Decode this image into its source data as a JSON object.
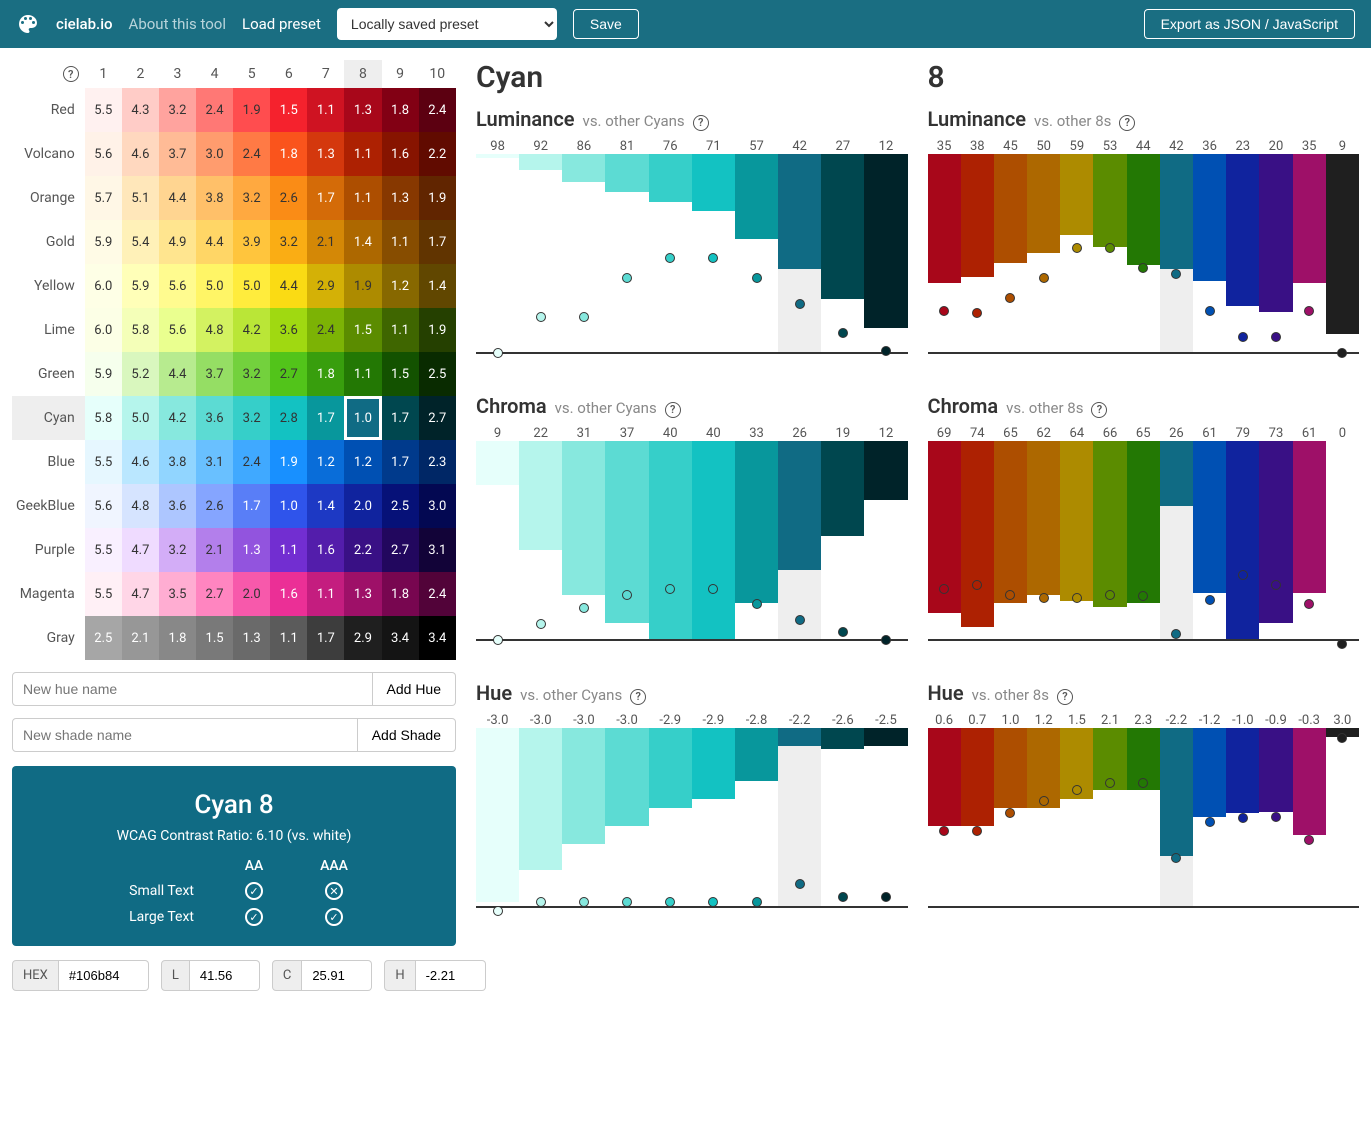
{
  "header": {
    "brand": "cielab.io",
    "about": "About this tool",
    "load_preset": "Load preset",
    "preset_value": "Locally saved preset",
    "save": "Save",
    "export": "Export as JSON / JavaScript"
  },
  "grid": {
    "columns": [
      "1",
      "2",
      "3",
      "4",
      "5",
      "6",
      "7",
      "8",
      "9",
      "10"
    ],
    "rows": [
      "Red",
      "Volcano",
      "Orange",
      "Gold",
      "Yellow",
      "Lime",
      "Green",
      "Cyan",
      "Blue",
      "GeekBlue",
      "Purple",
      "Magenta",
      "Gray"
    ],
    "selected_row": 7,
    "selected_col": 7,
    "cells": [
      {
        "row": "Red",
        "vals": [
          "5.5",
          "4.3",
          "3.2",
          "2.4",
          "1.9",
          "1.5",
          "1.1",
          "1.3",
          "1.8",
          "2.4"
        ],
        "colors": [
          "#fff1f0",
          "#ffccc7",
          "#ffa39e",
          "#ff7875",
          "#ff4d4f",
          "#f5222d",
          "#cf1322",
          "#a8071a",
          "#820014",
          "#5c0011"
        ]
      },
      {
        "row": "Volcano",
        "vals": [
          "5.6",
          "4.6",
          "3.7",
          "3.0",
          "2.4",
          "1.8",
          "1.3",
          "1.1",
          "1.6",
          "2.2"
        ],
        "colors": [
          "#fff2e8",
          "#ffd8bf",
          "#ffbb96",
          "#ff9c6e",
          "#ff7a45",
          "#fa541c",
          "#d4380d",
          "#ad2102",
          "#871400",
          "#610b00"
        ]
      },
      {
        "row": "Orange",
        "vals": [
          "5.7",
          "5.1",
          "4.4",
          "3.8",
          "3.2",
          "2.6",
          "1.7",
          "1.1",
          "1.3",
          "1.9"
        ],
        "colors": [
          "#fff7e6",
          "#ffe7ba",
          "#ffd591",
          "#ffc069",
          "#ffa940",
          "#fa8c16",
          "#d46b08",
          "#ad4e00",
          "#873800",
          "#612500"
        ]
      },
      {
        "row": "Gold",
        "vals": [
          "5.9",
          "5.4",
          "4.9",
          "4.4",
          "3.9",
          "3.2",
          "2.1",
          "1.4",
          "1.1",
          "1.7"
        ],
        "colors": [
          "#fffbe6",
          "#fff1b8",
          "#ffe58f",
          "#ffd666",
          "#ffc53d",
          "#faad14",
          "#d48806",
          "#ad6800",
          "#874d00",
          "#613400"
        ]
      },
      {
        "row": "Yellow",
        "vals": [
          "6.0",
          "5.9",
          "5.6",
          "5.0",
          "5.0",
          "4.4",
          "2.9",
          "1.9",
          "1.2",
          "1.4"
        ],
        "colors": [
          "#feffe6",
          "#ffffb8",
          "#fffb8f",
          "#fff566",
          "#ffec3d",
          "#fadb14",
          "#d4b106",
          "#ad8b00",
          "#876800",
          "#614700"
        ]
      },
      {
        "row": "Lime",
        "vals": [
          "6.0",
          "5.8",
          "5.6",
          "4.8",
          "4.2",
          "3.6",
          "2.4",
          "1.5",
          "1.1",
          "1.9"
        ],
        "colors": [
          "#fcffe6",
          "#f4ffb8",
          "#eaff8f",
          "#d3f261",
          "#bae637",
          "#a0d911",
          "#7cb305",
          "#5b8c00",
          "#3f6600",
          "#254000"
        ]
      },
      {
        "row": "Green",
        "vals": [
          "5.9",
          "5.2",
          "4.4",
          "3.7",
          "3.2",
          "2.7",
          "1.8",
          "1.1",
          "1.5",
          "2.5"
        ],
        "colors": [
          "#f6ffed",
          "#d9f7be",
          "#b7eb8f",
          "#95de64",
          "#73d13d",
          "#52c41a",
          "#389e0d",
          "#237804",
          "#135200",
          "#092b00"
        ]
      },
      {
        "row": "Cyan",
        "vals": [
          "5.8",
          "5.0",
          "4.2",
          "3.6",
          "3.2",
          "2.8",
          "1.7",
          "1.0",
          "1.7",
          "2.7"
        ],
        "colors": [
          "#e6fffb",
          "#b5f5ec",
          "#87e8de",
          "#5cdbd3",
          "#36cfc9",
          "#13c2c2",
          "#08979c",
          "#106b84",
          "#00474f",
          "#002329"
        ]
      },
      {
        "row": "Blue",
        "vals": [
          "5.5",
          "4.6",
          "3.8",
          "3.1",
          "2.4",
          "1.9",
          "1.2",
          "1.2",
          "1.7",
          "2.3"
        ],
        "colors": [
          "#e6f7ff",
          "#bae7ff",
          "#91d5ff",
          "#69c0ff",
          "#40a9ff",
          "#1890ff",
          "#096dd9",
          "#0050b3",
          "#003a8c",
          "#002766"
        ]
      },
      {
        "row": "GeekBlue",
        "vals": [
          "5.6",
          "4.8",
          "3.6",
          "2.6",
          "1.7",
          "1.0",
          "1.4",
          "2.0",
          "2.5",
          "3.0"
        ],
        "colors": [
          "#f0f5ff",
          "#d6e4ff",
          "#adc6ff",
          "#85a5ff",
          "#597ef7",
          "#2f54eb",
          "#1d39c4",
          "#10239e",
          "#061178",
          "#030852"
        ]
      },
      {
        "row": "Purple",
        "vals": [
          "5.5",
          "4.7",
          "3.2",
          "2.1",
          "1.3",
          "1.1",
          "1.6",
          "2.2",
          "2.7",
          "3.1"
        ],
        "colors": [
          "#f9f0ff",
          "#efdbff",
          "#d3adf7",
          "#b37feb",
          "#9254de",
          "#722ed1",
          "#531dab",
          "#391085",
          "#22075e",
          "#120338"
        ]
      },
      {
        "row": "Magenta",
        "vals": [
          "5.5",
          "4.7",
          "3.5",
          "2.7",
          "2.0",
          "1.6",
          "1.1",
          "1.3",
          "1.8",
          "2.4"
        ],
        "colors": [
          "#fff0f6",
          "#ffd6e7",
          "#ffadd2",
          "#ff85c0",
          "#f759ab",
          "#eb2f96",
          "#c41d7f",
          "#9e1068",
          "#780650",
          "#520339"
        ]
      },
      {
        "row": "Gray",
        "vals": [
          "2.5",
          "2.1",
          "1.8",
          "1.5",
          "1.3",
          "1.1",
          "1.7",
          "2.9",
          "3.4",
          "3.4"
        ],
        "colors": [
          "#a6a6a6",
          "#979797",
          "#888888",
          "#797979",
          "#6a6a6a",
          "#5b5b5b",
          "#3d3d3d",
          "#1f1f1f",
          "#141414",
          "#000000"
        ]
      }
    ],
    "text_light": [
      [
        false,
        false,
        false,
        false,
        false,
        true,
        true,
        true,
        true,
        true
      ],
      [
        false,
        false,
        false,
        false,
        false,
        true,
        true,
        true,
        true,
        true
      ],
      [
        false,
        false,
        false,
        false,
        false,
        false,
        true,
        true,
        true,
        true
      ],
      [
        false,
        false,
        false,
        false,
        false,
        false,
        false,
        true,
        true,
        true
      ],
      [
        false,
        false,
        false,
        false,
        false,
        false,
        false,
        false,
        true,
        true
      ],
      [
        false,
        false,
        false,
        false,
        false,
        false,
        false,
        true,
        true,
        true
      ],
      [
        false,
        false,
        false,
        false,
        false,
        false,
        true,
        true,
        true,
        true
      ],
      [
        false,
        false,
        false,
        false,
        false,
        false,
        true,
        true,
        true,
        true
      ],
      [
        false,
        false,
        false,
        false,
        false,
        true,
        true,
        true,
        true,
        true
      ],
      [
        false,
        false,
        false,
        false,
        true,
        true,
        true,
        true,
        true,
        true
      ],
      [
        false,
        false,
        false,
        false,
        true,
        true,
        true,
        true,
        true,
        true
      ],
      [
        false,
        false,
        false,
        false,
        false,
        true,
        true,
        true,
        true,
        true
      ],
      [
        true,
        true,
        true,
        true,
        true,
        true,
        true,
        true,
        true,
        true
      ]
    ]
  },
  "add_hue": {
    "placeholder": "New hue name",
    "button": "Add Hue"
  },
  "add_shade": {
    "placeholder": "New shade name",
    "button": "Add Shade"
  },
  "wcag": {
    "title": "Cyan 8",
    "ratio": "WCAG Contrast Ratio: 6.10 (vs. white)",
    "aa": "AA",
    "aaa": "AAA",
    "small": "Small Text",
    "large": "Large Text",
    "small_aa": true,
    "small_aaa": false,
    "large_aa": true,
    "large_aaa": true
  },
  "values": {
    "hex_lbl": "HEX",
    "hex": "#106b84",
    "l_lbl": "L",
    "l": "41.56",
    "c_lbl": "C",
    "c": "25.91",
    "h_lbl": "H",
    "h": "-2.21"
  },
  "col_left_title": "Cyan",
  "col_right_title": "8",
  "charts": {
    "lum_cyan": {
      "title": "Luminance",
      "sub": "vs. other Cyans",
      "labels": [
        "98",
        "92",
        "86",
        "81",
        "76",
        "71",
        "57",
        "42",
        "27",
        "12"
      ],
      "heights": [
        2,
        8,
        14,
        19,
        24,
        29,
        43,
        58,
        73,
        88
      ],
      "dots": [
        98,
        80,
        80,
        60,
        50,
        50,
        60,
        73,
        88,
        97
      ],
      "colors": [
        "#e6fffb",
        "#b5f5ec",
        "#87e8de",
        "#5cdbd3",
        "#36cfc9",
        "#13c2c2",
        "#08979c",
        "#106b84",
        "#00474f",
        "#002329"
      ],
      "sel": 7
    },
    "lum_8": {
      "title": "Luminance",
      "sub": "vs. other 8s",
      "labels": [
        "35",
        "38",
        "45",
        "50",
        "59",
        "53",
        "44",
        "42",
        "36",
        "23",
        "20",
        "35",
        "9"
      ],
      "heights": [
        65,
        62,
        55,
        50,
        41,
        47,
        56,
        58,
        64,
        77,
        80,
        65,
        91
      ],
      "dots": [
        77,
        78,
        70,
        60,
        45,
        45,
        55,
        58,
        77,
        90,
        90,
        77,
        98
      ],
      "colors": [
        "#a8071a",
        "#ad2102",
        "#ad4e00",
        "#ad6800",
        "#ad8b00",
        "#5b8c00",
        "#237804",
        "#106b84",
        "#0050b3",
        "#10239e",
        "#391085",
        "#9e1068",
        "#1f1f1f"
      ],
      "sel": 7
    },
    "chr_cyan": {
      "title": "Chroma",
      "sub": "vs. other Cyans",
      "labels": [
        "9",
        "22",
        "31",
        "37",
        "40",
        "40",
        "33",
        "26",
        "19",
        "12"
      ],
      "heights": [
        22,
        55,
        78,
        92,
        100,
        100,
        82,
        65,
        48,
        30
      ],
      "dots": [
        98,
        90,
        82,
        75,
        72,
        72,
        80,
        88,
        94,
        98
      ],
      "colors": [
        "#e6fffb",
        "#b5f5ec",
        "#87e8de",
        "#5cdbd3",
        "#36cfc9",
        "#13c2c2",
        "#08979c",
        "#106b84",
        "#00474f",
        "#002329"
      ],
      "sel": 7
    },
    "chr_8": {
      "title": "Chroma",
      "sub": "vs. other 8s",
      "labels": [
        "69",
        "74",
        "65",
        "62",
        "64",
        "66",
        "65",
        "26",
        "61",
        "79",
        "73",
        "61",
        "0"
      ],
      "heights": [
        87,
        94,
        82,
        78,
        81,
        84,
        82,
        33,
        77,
        100,
        92,
        77,
        0
      ],
      "dots": [
        72,
        70,
        75,
        77,
        77,
        75,
        76,
        95,
        78,
        65,
        70,
        80,
        100
      ],
      "colors": [
        "#a8071a",
        "#ad2102",
        "#ad4e00",
        "#ad6800",
        "#ad8b00",
        "#5b8c00",
        "#237804",
        "#106b84",
        "#0050b3",
        "#10239e",
        "#391085",
        "#9e1068",
        "#1f1f1f"
      ],
      "sel": 7
    },
    "hue_cyan": {
      "title": "Hue",
      "sub": "vs. other Cyans",
      "labels": [
        "-3.0",
        "-3.0",
        "-3.0",
        "-3.0",
        "-2.9",
        "-2.9",
        "-2.8",
        "-2.2",
        "-2.6",
        "-2.5"
      ],
      "heights": [
        98,
        80,
        65,
        55,
        45,
        40,
        30,
        10,
        12,
        10
      ],
      "dots": [
        100,
        95,
        95,
        95,
        95,
        95,
        95,
        85,
        92,
        92
      ],
      "colors": [
        "#e6fffb",
        "#b5f5ec",
        "#87e8de",
        "#5cdbd3",
        "#36cfc9",
        "#13c2c2",
        "#08979c",
        "#106b84",
        "#00474f",
        "#002329"
      ],
      "sel": 7
    },
    "hue_8": {
      "title": "Hue",
      "sub": "vs. other 8s",
      "labels": [
        "0.6",
        "0.7",
        "1.0",
        "1.2",
        "1.5",
        "2.1",
        "2.3",
        "-2.2",
        "-1.2",
        "-1.0",
        "-0.9",
        "-0.3",
        "3.0"
      ],
      "heights": [
        55,
        55,
        45,
        45,
        40,
        35,
        35,
        72,
        50,
        48,
        47,
        60,
        5
      ],
      "dots": [
        55,
        55,
        45,
        38,
        32,
        28,
        28,
        70,
        50,
        48,
        47,
        60,
        3
      ],
      "colors": [
        "#a8071a",
        "#ad2102",
        "#ad4e00",
        "#ad6800",
        "#ad8b00",
        "#5b8c00",
        "#237804",
        "#106b84",
        "#0050b3",
        "#10239e",
        "#391085",
        "#9e1068",
        "#1f1f1f"
      ],
      "sel": 7
    }
  },
  "chart_data": [
    {
      "type": "bar",
      "title": "Luminance vs. other Cyans",
      "categories": [
        "1",
        "2",
        "3",
        "4",
        "5",
        "6",
        "7",
        "8",
        "9",
        "10"
      ],
      "values": [
        98,
        92,
        86,
        81,
        76,
        71,
        57,
        42,
        27,
        12
      ]
    },
    {
      "type": "bar",
      "title": "Luminance vs. other 8s",
      "categories": [
        "Red",
        "Volcano",
        "Orange",
        "Gold",
        "Yellow",
        "Lime",
        "Green",
        "Cyan",
        "Blue",
        "GeekBlue",
        "Purple",
        "Magenta",
        "Gray"
      ],
      "values": [
        35,
        38,
        45,
        50,
        59,
        53,
        44,
        42,
        36,
        23,
        20,
        35,
        9
      ]
    },
    {
      "type": "bar",
      "title": "Chroma vs. other Cyans",
      "categories": [
        "1",
        "2",
        "3",
        "4",
        "5",
        "6",
        "7",
        "8",
        "9",
        "10"
      ],
      "values": [
        9,
        22,
        31,
        37,
        40,
        40,
        33,
        26,
        19,
        12
      ]
    },
    {
      "type": "bar",
      "title": "Chroma vs. other 8s",
      "categories": [
        "Red",
        "Volcano",
        "Orange",
        "Gold",
        "Yellow",
        "Lime",
        "Green",
        "Cyan",
        "Blue",
        "GeekBlue",
        "Purple",
        "Magenta",
        "Gray"
      ],
      "values": [
        69,
        74,
        65,
        62,
        64,
        66,
        65,
        26,
        61,
        79,
        73,
        61,
        0
      ]
    },
    {
      "type": "bar",
      "title": "Hue vs. other Cyans",
      "categories": [
        "1",
        "2",
        "3",
        "4",
        "5",
        "6",
        "7",
        "8",
        "9",
        "10"
      ],
      "values": [
        -3.0,
        -3.0,
        -3.0,
        -3.0,
        -2.9,
        -2.9,
        -2.8,
        -2.2,
        -2.6,
        -2.5
      ]
    },
    {
      "type": "bar",
      "title": "Hue vs. other 8s",
      "categories": [
        "Red",
        "Volcano",
        "Orange",
        "Gold",
        "Yellow",
        "Lime",
        "Green",
        "Cyan",
        "Blue",
        "GeekBlue",
        "Purple",
        "Magenta",
        "Gray"
      ],
      "values": [
        0.6,
        0.7,
        1.0,
        1.2,
        1.5,
        2.1,
        2.3,
        -2.2,
        -1.2,
        -1.0,
        -0.9,
        -0.3,
        3.0
      ]
    }
  ]
}
